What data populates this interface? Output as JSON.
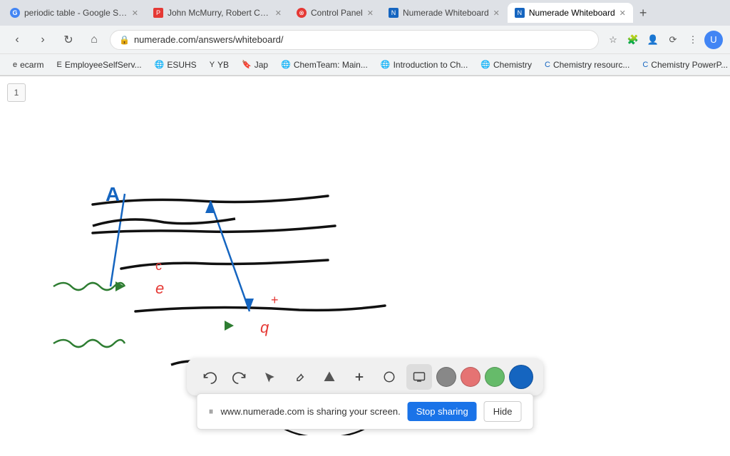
{
  "browser": {
    "tabs": [
      {
        "id": "tab1",
        "favicon": "G",
        "favicon_color": "#4285f4",
        "title": "periodic table - Google Search",
        "active": false,
        "closable": true
      },
      {
        "id": "tab2",
        "favicon": "📄",
        "favicon_color": "#e53935",
        "title": "John McMurry, Robert C. Fay...",
        "active": false,
        "closable": true
      },
      {
        "id": "tab3",
        "favicon": "⚙",
        "favicon_color": "#555",
        "title": "Control Panel",
        "active": false,
        "closable": true
      },
      {
        "id": "tab4",
        "favicon": "N",
        "favicon_color": "#1565c0",
        "title": "Numerade Whiteboard",
        "active": false,
        "closable": true
      },
      {
        "id": "tab5",
        "favicon": "N",
        "favicon_color": "#1565c0",
        "title": "Numerade Whiteboard",
        "active": true,
        "closable": true
      }
    ],
    "url": "numerade.com/answers/whiteboard/",
    "bookmarks": [
      {
        "label": "ecarm",
        "favicon": "e"
      },
      {
        "label": "EmployeeSelfServ...",
        "favicon": "E"
      },
      {
        "label": "ESUHS",
        "favicon": "🌐"
      },
      {
        "label": "YB",
        "favicon": "Y"
      },
      {
        "label": "Jap",
        "favicon": "🔖"
      },
      {
        "label": "ChemTeam: Main...",
        "favicon": "🌐"
      },
      {
        "label": "Introduction to Ch...",
        "favicon": "🌐"
      },
      {
        "label": "Chemistry",
        "favicon": "🌐"
      },
      {
        "label": "Chemistry resourc...",
        "favicon": "C"
      },
      {
        "label": "Chemistry PowerP...",
        "favicon": "C"
      }
    ]
  },
  "whiteboard": {
    "page_number": "1"
  },
  "toolbar": {
    "undo_label": "↩",
    "redo_label": "↪",
    "select_label": "▲",
    "pen_label": "✏",
    "shapes_label": "▲",
    "plus_label": "+",
    "eraser_label": "◯",
    "screen_label": "⬛",
    "colors": [
      "#888888",
      "#e53935",
      "#4caf50",
      "#1565c0"
    ]
  },
  "screen_share": {
    "message": "www.numerade.com is sharing your screen.",
    "stop_label": "Stop sharing",
    "hide_label": "Hide"
  }
}
